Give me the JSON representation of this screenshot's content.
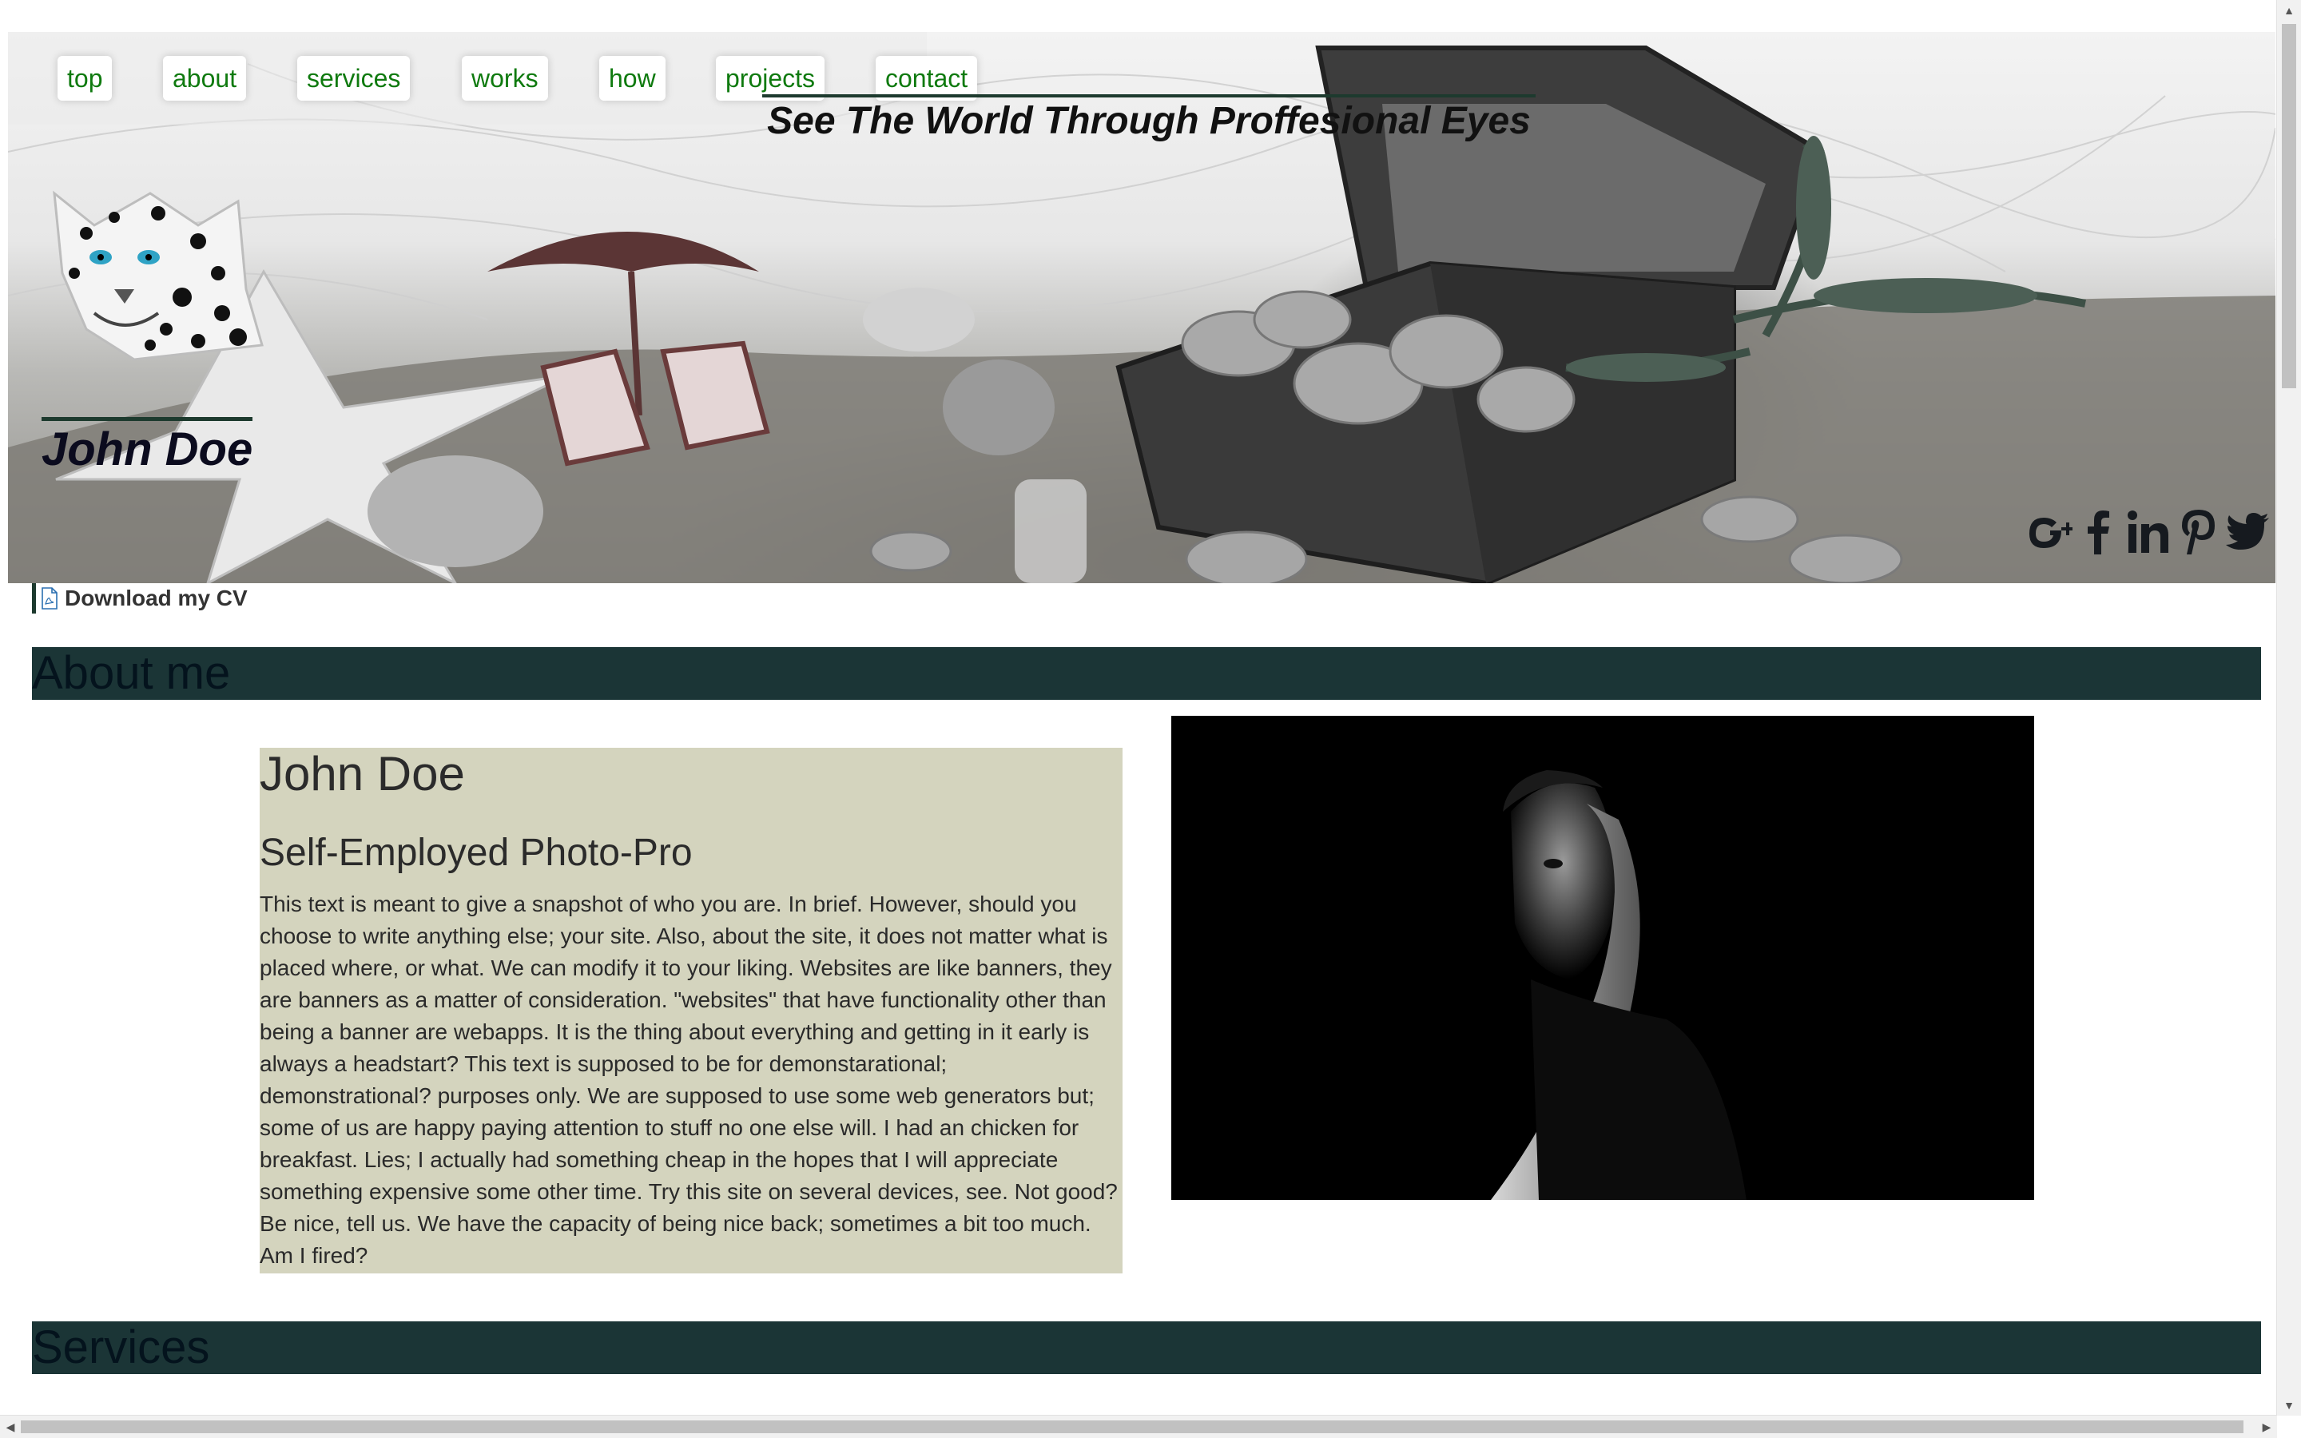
{
  "nav": {
    "items": [
      {
        "label": "top"
      },
      {
        "label": "about"
      },
      {
        "label": "services"
      },
      {
        "label": "works"
      },
      {
        "label": "how"
      },
      {
        "label": "projects"
      },
      {
        "label": "contact"
      }
    ]
  },
  "hero": {
    "tagline": "See The World Through Proffesional Eyes",
    "name": "John Doe",
    "logo_icon": "snow-leopard-icon",
    "social_icons": [
      "google-plus-icon",
      "facebook-icon",
      "linkedin-icon",
      "pinterest-icon",
      "twitter-icon"
    ]
  },
  "cv": {
    "label": "Download my CV",
    "icon": "pdf-icon"
  },
  "about": {
    "heading": "About me",
    "name": "John Doe",
    "role": "Self-Employed Photo-Pro",
    "bio": "This text is meant to give a snapshot of who you are. In brief. However, should you choose to write anything else; your site. Also, about the site, it does not matter what is placed where, or what. We can modify it to your liking. Websites are like banners, they are banners as a matter of consideration. \"websites\" that have functionality other than being a banner are webapps. It is the thing about everything and getting in it early is always a headstart? This text is supposed to be for demonstarational; demonstrational? purposes only. We are supposed to use some web generators but; some of us are happy paying attention to stuff no one else will. I had an chicken for breakfast. Lies; I actually had something cheap in the hopes that I will appreciate something expensive some other time. Try this site on several devices, see. Not good? Be nice, tell us. We have the capacity of being nice back; sometimes a bit too much. Am I fired?"
  },
  "services": {
    "heading": "Services"
  },
  "colors": {
    "nav_link": "#0f7a0f",
    "section_bar": "#1b3536",
    "about_card": "#d4d4be",
    "accent_line": "#1d3a2e"
  }
}
